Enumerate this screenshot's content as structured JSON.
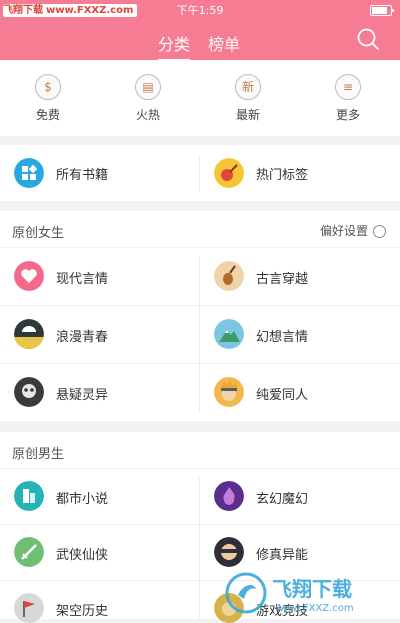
{
  "status": {
    "watermark_brand": "飞翔下载",
    "watermark_url": "www.FXXZ.com",
    "time": "下午1:59"
  },
  "header": {
    "tab_active": "分类",
    "tab_other": "榜单"
  },
  "quick": [
    {
      "label": "免费",
      "glyph": "$",
      "icon": "dollar-icon"
    },
    {
      "label": "火热",
      "glyph": "▤",
      "icon": "list-icon"
    },
    {
      "label": "最新",
      "glyph": "新",
      "icon": "new-icon"
    },
    {
      "label": "更多",
      "glyph": "≡",
      "icon": "menu-icon"
    }
  ],
  "top_row": {
    "left": "所有书籍",
    "right": "热门标签"
  },
  "female": {
    "title": "原创女生",
    "pref": "偏好设置",
    "items": [
      "现代言情",
      "古言穿越",
      "浪漫青春",
      "幻想言情",
      "悬疑灵异",
      "纯爱同人"
    ]
  },
  "male": {
    "title": "原创男生",
    "items": [
      "都市小说",
      "玄幻魔幻",
      "武侠仙侠",
      "修真异能",
      "架空历史",
      "游戏竞技"
    ]
  },
  "corner_watermark": {
    "text": "飞翔下载",
    "url": "www.FXXZ.com"
  },
  "colors": {
    "header": "#f57c92",
    "divider": "#f2f2f2"
  }
}
